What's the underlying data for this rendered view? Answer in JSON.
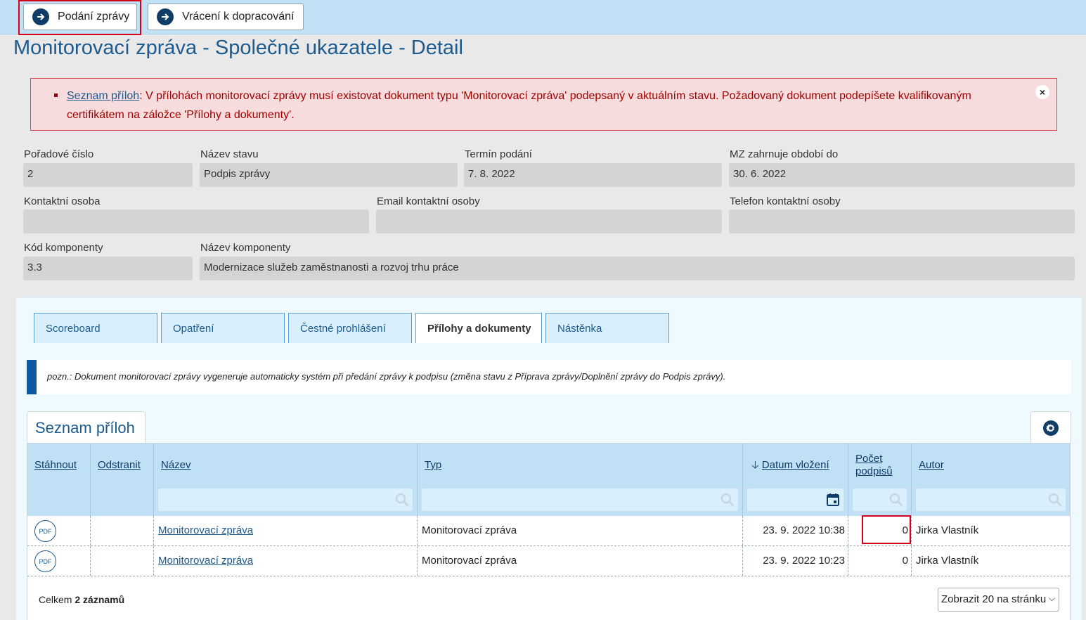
{
  "toolbar": {
    "submit_label": "Podání zprávy",
    "return_label": "Vrácení k dopracování"
  },
  "page": {
    "title": "Monitorovací zpráva - Společné ukazatele - Detail"
  },
  "error": {
    "link": "Seznam příloh",
    "text": ": V přílohách monitorovací zprávy musí existovat dokument typu 'Monitorovací zpráva' podepsaný v aktuálním stavu. Požadovaný dokument podepíšete kvalifikovaným certifikátem na záložce 'Přílohy a dokumenty'.",
    "close": "×"
  },
  "fields": {
    "poradove_cislo": {
      "label": "Pořadové číslo",
      "value": "2"
    },
    "nazev_stavu": {
      "label": "Název stavu",
      "value": "Podpis zprávy"
    },
    "termin_podani": {
      "label": "Termín podání",
      "value": "7. 8. 2022"
    },
    "obdobi_do": {
      "label": "MZ zahrnuje období do",
      "value": "30. 6. 2022"
    },
    "kontaktni_osoba": {
      "label": "Kontaktní osoba",
      "value": ""
    },
    "email": {
      "label": "Email kontaktní osoby",
      "value": ""
    },
    "telefon": {
      "label": "Telefon kontaktní osoby",
      "value": ""
    },
    "kod_komponenty": {
      "label": "Kód komponenty",
      "value": "3.3"
    },
    "nazev_komponenty": {
      "label": "Název komponenty",
      "value": "Modernizace služeb zaměstnanosti a rozvoj trhu práce"
    }
  },
  "tabs": [
    {
      "label": "Scoreboard"
    },
    {
      "label": "Opatření"
    },
    {
      "label": "Čestné prohlášení"
    },
    {
      "label": "Přílohy a dokumenty"
    },
    {
      "label": "Nástěnka"
    }
  ],
  "note": "pozn.: Dokument monitorovací zprávy vygeneruje automaticky systém při předání zprávy k podpisu (změna stavu z Příprava zprávy/Doplnění zprávy do Podpis zprávy).",
  "list": {
    "title": "Seznam příloh",
    "columns": {
      "download": "Stáhnout",
      "remove": "Odstranit",
      "name": "Název",
      "type": "Typ",
      "date": "Datum vložení",
      "sig_count_1": "Počet",
      "sig_count_2": "podpisů",
      "author": "Autor"
    },
    "rows": [
      {
        "pdf": "PDF",
        "name": "Monitorovací zpráva",
        "type": "Monitorovací zpráva",
        "date": "23. 9. 2022 10:38",
        "sigs": "0",
        "author": "Jirka Vlastník"
      },
      {
        "pdf": "PDF",
        "name": "Monitorovací zpráva",
        "type": "Monitorovací zpráva",
        "date": "23. 9. 2022 10:23",
        "sigs": "0",
        "author": "Jirka Vlastník"
      }
    ],
    "total_prefix": "Celkem ",
    "total_bold": "2 záznamů",
    "page_size": "Zobrazit 20 na stránku"
  },
  "colors": {
    "accent": "#1d5a8e",
    "error": "#a30000",
    "header": "#bfe0f5"
  }
}
